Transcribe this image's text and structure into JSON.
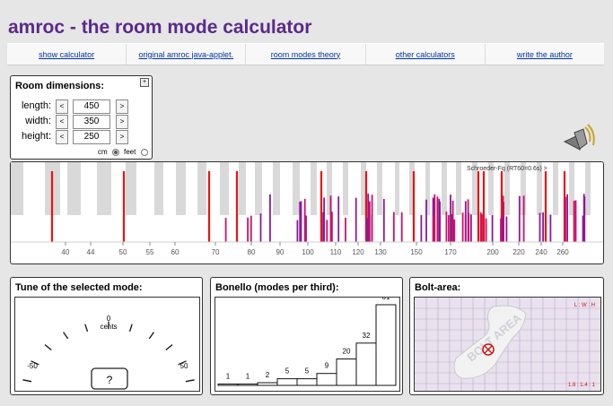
{
  "header": {
    "title": "amroc - the room mode calculator"
  },
  "nav": [
    {
      "label": "show calculator"
    },
    {
      "label": "original amroc java-applet."
    },
    {
      "label": "room modes theory"
    },
    {
      "label": "other calculators"
    },
    {
      "label": "write the author"
    }
  ],
  "room": {
    "title": "Room dimensions:",
    "expand_glyph": "+",
    "dec_label": "<",
    "inc_label": ">",
    "rows": [
      {
        "label": "length:",
        "value": "450"
      },
      {
        "label": "width:",
        "value": "350"
      },
      {
        "label": "height:",
        "value": "250"
      }
    ],
    "unit_cm": "cm",
    "unit_feet": "feet",
    "unit_selected": "cm"
  },
  "spectrum": {
    "schroeder_label": "Schroeder-Fq (RT60=0.6s) >",
    "freq_ticks": [
      "40",
      "44",
      "50",
      "55",
      "60",
      "70",
      "80",
      "90",
      "100",
      "110",
      "120",
      "130",
      "150",
      "170",
      "200",
      "220",
      "240",
      "260"
    ]
  },
  "tune": {
    "title": "Tune of the selected mode:",
    "zero_label": "0",
    "cents_label": "cents",
    "min_label": "-50",
    "max_label": "50",
    "readout": "?"
  },
  "bonello": {
    "title": "Bonello (modes per third):",
    "values": [
      1,
      1,
      2,
      5,
      5,
      9,
      20,
      32,
      61
    ]
  },
  "bolt": {
    "title": "Bolt-area:",
    "ratio_label": "L : W : H",
    "ratio_value": "1.8 : 1.4 : 1",
    "watermark": "BOLT AREA"
  },
  "colors": {
    "title": "#5a2a8a",
    "axial": "#ee1111",
    "tangential": "#cc1166",
    "oblique": "#8a1a9a",
    "link": "#0033aa"
  }
}
